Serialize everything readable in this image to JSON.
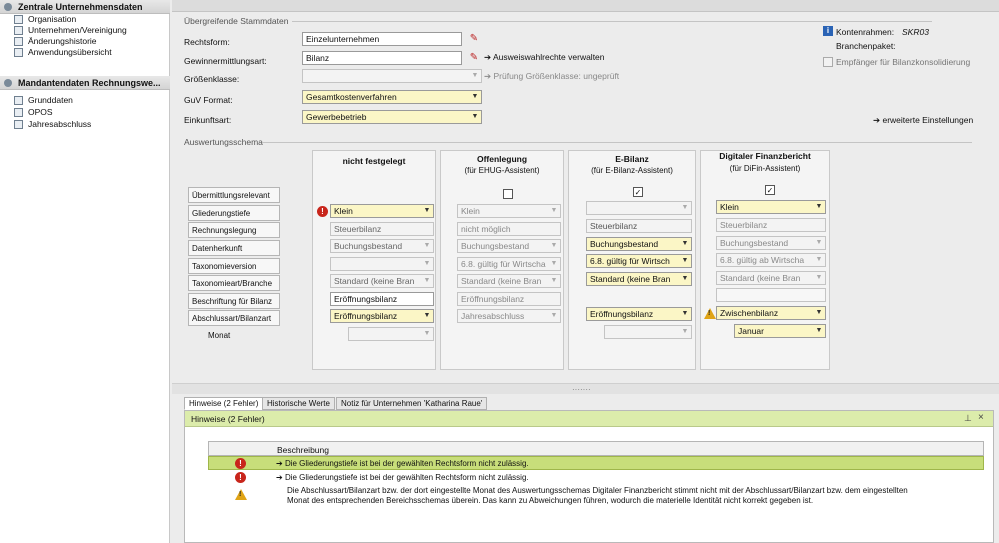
{
  "nav": {
    "section1_title": "Zentrale Unternehmensdaten",
    "section1_items": [
      "Organisation",
      "Unternehmen/Vereinigung",
      "Änderungshistorie",
      "Anwendungsübersicht"
    ],
    "section2_title": "Mandantendaten Rechnungswe...",
    "section2_items": [
      "Grunddaten",
      "OPOS",
      "Jahresabschluss"
    ]
  },
  "stamm": {
    "section_title": "Übergreifende Stammdaten",
    "rechtsform_label": "Rechtsform:",
    "rechtsform_value": "Einzelunternehmen",
    "gewinn_label": "Gewinnermittlungsart:",
    "gewinn_value": "Bilanz",
    "groessen_label": "Größenklasse:",
    "guv_label": "GuV Format:",
    "guv_value": "Gesamtkostenverfahren",
    "einkunft_label": "Einkunftsart:",
    "einkunft_value": "Gewerbebetrieb",
    "link_ausweis": "Ausweiswahlrechte verwalten",
    "link_pruefung": "Prüfung Größenklasse: ungeprüft",
    "kontenrahmen_label": "Kontenrahmen:",
    "kontenrahmen_value": "SKR03",
    "branchenpaket_label": "Branchenpaket:",
    "empfaenger_label": "Empfänger für Bilanzkonsolidierung",
    "link_erweitert": "erweiterte Einstellungen"
  },
  "schema": {
    "section_title": "Auswertungsschema",
    "rows": [
      "Übermittlungsrelevant",
      "Gliederungstiefe",
      "Rechnungslegung",
      "Datenherkunft",
      "Taxonomieversion",
      "Taxonomieart/Branche",
      "Beschriftung für Bilanz",
      "Abschlussart/Bilanzart",
      "Monat"
    ],
    "col1": {
      "title": "nicht festgelegt",
      "gliederung": "Klein",
      "rechnung": "Steuerbilanz",
      "daten": "Buchungsbestand",
      "taxart": "Standard  (keine Bran",
      "beschriftung": "Eröffnungsbilanz",
      "abschluss": "Eröffnungsbilanz"
    },
    "col2": {
      "title": "Offenlegung",
      "subtitle": "(für EHUG-Assistent)",
      "gliederung": "Klein",
      "rechnung": "nicht möglich",
      "daten": "Buchungsbestand",
      "taxver": "6.8. gültig für Wirtscha",
      "taxart": "Standard  (keine Bran",
      "beschriftung": "Eröffnungsbilanz",
      "abschluss": "Jahresabschluss"
    },
    "col3": {
      "title": "E-Bilanz",
      "subtitle": "(für E-Bilanz-Assistent)",
      "rechnung": "Steuerbilanz",
      "daten": "Buchungsbestand",
      "taxver": "6.8. gültig für Wirtsch",
      "taxart": "Standard  (keine Bran",
      "abschluss": "Eröffnungsbilanz"
    },
    "col4": {
      "title": "Digitaler Finanzbericht",
      "subtitle": "(für DiFin-Assistent)",
      "gliederung": "Klein",
      "rechnung": "Steuerbilanz",
      "daten": "Buchungsbestand",
      "taxver": "6.8. gültig ab Wirtscha",
      "taxart": "Standard  (keine Bran",
      "abschluss": "Zwischenbilanz",
      "monat": "Januar"
    }
  },
  "bottom": {
    "tabs": [
      "Hinweise (2 Fehler)",
      "Historische Werte",
      "Notiz für Unternehmen 'Katharina Raue'"
    ],
    "panel_title": "Hinweise (2 Fehler)",
    "col_header": "Beschreibung",
    "messages": [
      "Die Gliederungstiefe ist bei der gewählten Rechtsform nicht zulässig.",
      "Die Gliederungstiefe ist bei der gewählten Rechtsform nicht zulässig.",
      "Die Abschlussart/Bilanzart bzw. der dort eingestellte Monat des Auswertungsschemas Digitaler Finanzbericht stimmt nicht mit der Abschlussart/Bilanzart bzw. dem eingestellten",
      "Monat des entsprechenden Bereichsschemas überein.  Das kann zu Abweichungen führen, wodurch die materielle Identität nicht korrekt gegeben ist."
    ]
  },
  "colors": {
    "yellow_field": "#fbf6c6",
    "selected_row": "#c8de7a",
    "panel_title": "#dcecab",
    "error": "#c8251b",
    "warning": "#e0a416"
  }
}
